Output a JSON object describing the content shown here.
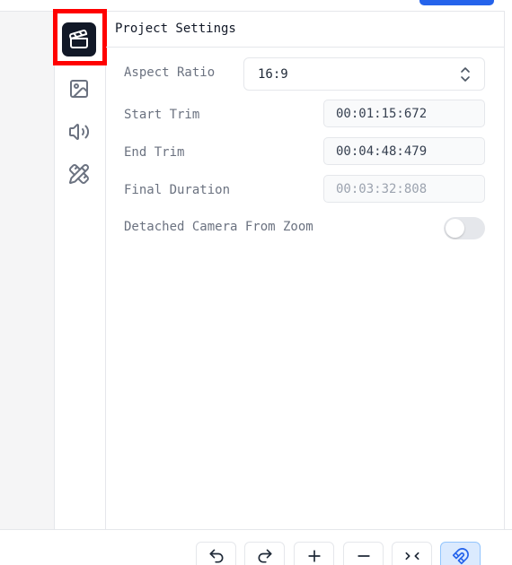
{
  "panel": {
    "title": "Project Settings"
  },
  "sidebar": {
    "items": [
      {
        "name": "project",
        "icon": "clapperboard-icon",
        "active": true
      },
      {
        "name": "image",
        "icon": "image-icon",
        "active": false
      },
      {
        "name": "audio",
        "icon": "speaker-icon",
        "active": false
      },
      {
        "name": "design",
        "icon": "pencil-ruler-icon",
        "active": false
      }
    ]
  },
  "settings": {
    "aspect_ratio": {
      "label": "Aspect Ratio",
      "value": "16:9"
    },
    "start_trim": {
      "label": "Start Trim",
      "value": "00:01:15:672"
    },
    "end_trim": {
      "label": "End Trim",
      "value": "00:04:48:479"
    },
    "final_duration": {
      "label": "Final Duration",
      "value": "00:03:32:808"
    },
    "detached_camera": {
      "label": "Detached Camera From Zoom",
      "enabled": false
    }
  },
  "toolbar": {
    "items": [
      "undo-icon",
      "redo-icon",
      "plus-icon",
      "minus-icon",
      "collapse-icon",
      "magnet-icon"
    ]
  },
  "colors": {
    "accent": "#2563eb",
    "active_rail": "#111827",
    "highlight": "#ff0000"
  }
}
